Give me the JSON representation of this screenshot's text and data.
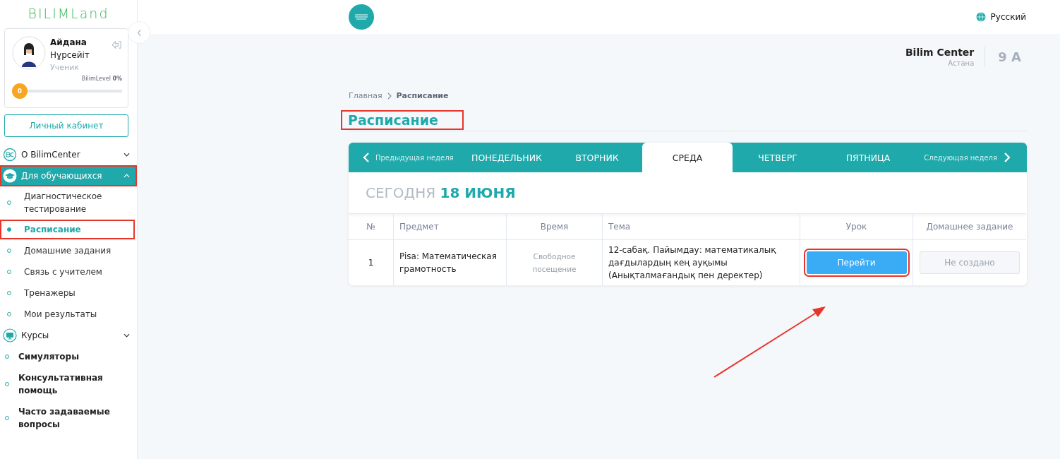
{
  "sidebar": {
    "logo": "BILIMLand",
    "profile": {
      "first_name": "Айдана",
      "last_name": "Нұрсейіт",
      "role": "Ученик",
      "level_label": "BilimLevel",
      "level_value": "0%",
      "level_badge": "0",
      "level": 0
    },
    "cabinet_button": "Личный кабинет",
    "nav": [
      {
        "kind": "bc",
        "label": "О BilimCenter",
        "expanded": false,
        "highlighted": false
      },
      {
        "kind": "cap",
        "label": "Для обучающихся",
        "expanded": true,
        "highlighted": true,
        "children": [
          {
            "label": "Диагностическое тестирование",
            "selected": false,
            "highlighted": false
          },
          {
            "label": "Расписание",
            "selected": true,
            "highlighted": true
          },
          {
            "label": "Домашние задания",
            "selected": false,
            "highlighted": false
          },
          {
            "label": "Связь с учителем",
            "selected": false,
            "highlighted": false
          },
          {
            "label": "Тренажеры",
            "selected": false,
            "highlighted": false
          },
          {
            "label": "Мои результаты",
            "selected": false,
            "highlighted": false
          }
        ]
      },
      {
        "kind": "monitor",
        "label": "Курсы",
        "expanded": false,
        "highlighted": false
      }
    ],
    "links": [
      "Симуляторы",
      "Консультативная помощь",
      "Часто задаваемые вопросы"
    ]
  },
  "header": {
    "language": "Русский",
    "school": "Bilim Center",
    "city": "Астана",
    "class": "9 А"
  },
  "breadcrumbs": [
    "Главная",
    "Расписание"
  ],
  "page_title": {
    "text": "Расписание",
    "highlighted": true
  },
  "week_nav": {
    "previous": "Предыдущая неделя",
    "next": "Следующая неделя",
    "days": [
      {
        "label": "ПОНЕДЕЛЬНИК",
        "selected": false
      },
      {
        "label": "ВТОРНИК",
        "selected": false
      },
      {
        "label": "СРЕДА",
        "selected": true
      },
      {
        "label": "ЧЕТВЕРГ",
        "selected": false
      },
      {
        "label": "ПЯТНИЦА",
        "selected": false
      }
    ]
  },
  "today": "СЕГОДНЯ **18 ИЮНЯ**",
  "table": {
    "columns": [
      "№",
      "Предмет",
      "Время",
      "Тема",
      "Урок",
      "Домашнее задание"
    ],
    "rows": [
      {
        "number": "1",
        "subject": "Pisa: Математическая грамотность",
        "time": "Свободное посещение",
        "topic": "12-сабақ. Пайымдау: математикалық дағдылардың кең ауқымы (Анықталмағандық пен деректер)",
        "lesson": {
          "label": "Перейти",
          "disabled": false,
          "highlighted": true
        },
        "homework": {
          "label": "Не создано",
          "disabled": true,
          "highlighted": false
        }
      }
    ]
  },
  "annotation_arrow": true
}
